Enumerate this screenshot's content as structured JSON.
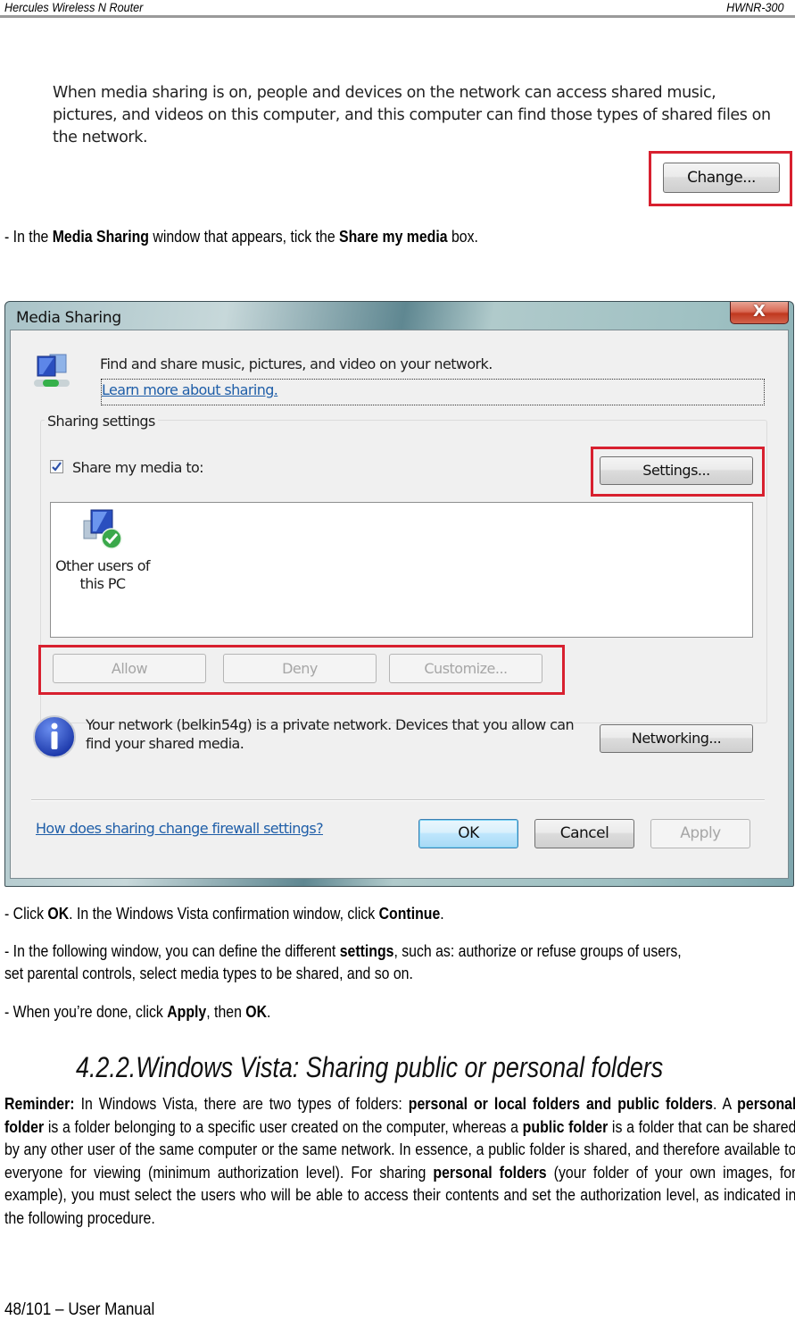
{
  "header": {
    "left": "Hercules Wireless N Router",
    "right": "HWNR-300"
  },
  "snippet": {
    "text": "When media sharing is on, people and devices on the network can access shared music, pictures, and videos on this computer, and this computer can find those types of shared files on the network.",
    "change_button": "Change..."
  },
  "step1": {
    "prefix": "- In the ",
    "b1": "Media Sharing",
    "mid": " window that appears, tick the ",
    "b2": "Share my media",
    "suffix": " box."
  },
  "dialog": {
    "title": "Media Sharing",
    "close_glyph": "X",
    "intro": "Find and share music, pictures, and video on your network.",
    "learn_more": "Learn more about sharing.",
    "group_label": "Sharing settings",
    "share_checkbox_label": "Share my media to:",
    "share_checked": true,
    "settings_button": "Settings...",
    "list_item_label_line1": "Other users of",
    "list_item_label_line2": "this PC",
    "allow_button": "Allow",
    "deny_button": "Deny",
    "customize_button": "Customize...",
    "info_line1": "Your network (belkin54g) is a private network. Devices that you allow can",
    "info_line2": "find your shared media.",
    "networking_button": "Networking...",
    "firewall_link": "How does sharing change firewall settings?",
    "ok_button": "OK",
    "cancel_button": "Cancel",
    "apply_button": "Apply"
  },
  "step2": {
    "prefix": "- Click ",
    "b1": "OK",
    "mid": ".  In the Windows Vista confirmation window, click ",
    "b2": "Continue",
    "suffix": "."
  },
  "step3": {
    "prefix": "- In the following window, you can define the different ",
    "b1": "settings",
    "line1_suffix": ", such as: authorize or refuse groups of users,",
    "line2": "set parental controls, select media types to be shared, and so on."
  },
  "step4": {
    "prefix": "- When you’re done, click ",
    "b1": "Apply",
    "mid": ", then ",
    "b2": "OK",
    "suffix": "."
  },
  "section": {
    "title": "4.2.2.Windows Vista: Sharing public or personal folders"
  },
  "reminder": {
    "b_reminder": "Reminder:",
    "t1": " In Windows Vista, there are two types of folders: ",
    "b_types": "personal or local folders and public folders",
    "t2": ". A ",
    "b_personal": "personal folder",
    "t3": " is a folder belonging to a specific user created on the computer, whereas a ",
    "b_public": "public folder",
    "t4": " is a folder that can be shared by any other user of the same computer or the same network.  In essence, a public folder is shared, and therefore available to everyone for viewing (minimum authorization level).  For sharing ",
    "b_personal_folders": "personal folders",
    "t5": " (your folder of your own images, for example), you must select the users who will be able to access their contents and set the authorization level, as indicated in the following procedure."
  },
  "footer": {
    "page": "48/101 – User Manual"
  },
  "colors": {
    "highlight_red": "#d8202f",
    "link_blue": "#1f5ea8"
  }
}
